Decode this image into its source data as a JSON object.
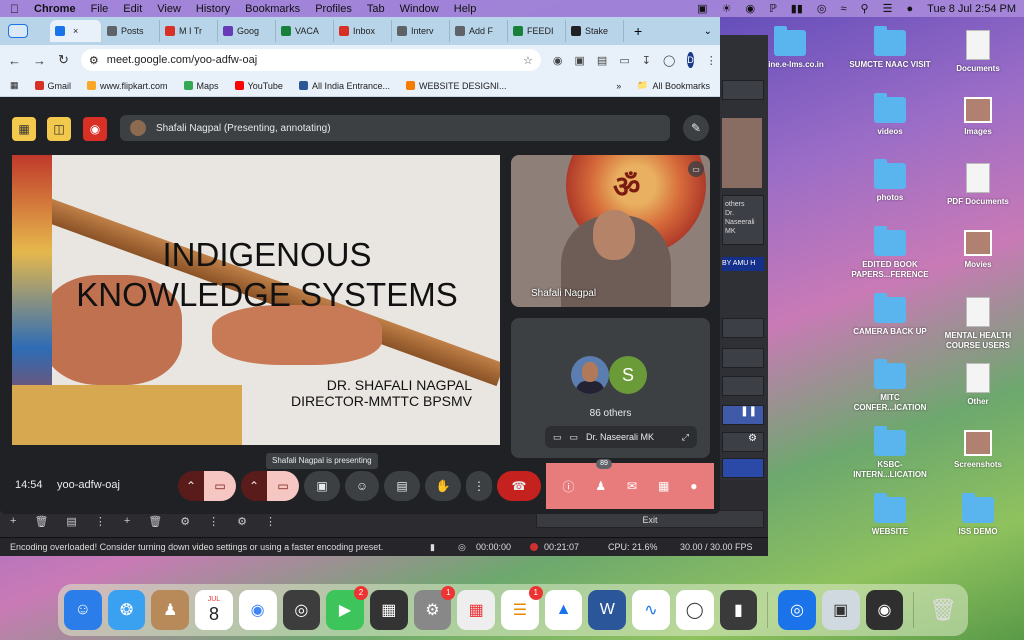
{
  "menubar": {
    "app": "Chrome",
    "items": [
      "File",
      "Edit",
      "View",
      "History",
      "Bookmarks",
      "Profiles",
      "Tab",
      "Window",
      "Help"
    ],
    "clock": "Tue 8 Jul  2:54 PM"
  },
  "tabs": [
    {
      "label": "",
      "color": "#1a73e8"
    },
    {
      "label": "Posts",
      "color": "#5f6368"
    },
    {
      "label": "M I Tr",
      "color": "#d93025"
    },
    {
      "label": "Goog",
      "color": "#673ab7"
    },
    {
      "label": "VACA",
      "color": "#188038"
    },
    {
      "label": "Inbox",
      "color": "#d93025"
    },
    {
      "label": "Interv",
      "color": "#5f6368"
    },
    {
      "label": "Add F",
      "color": "#5f6368"
    },
    {
      "label": "FEEDI",
      "color": "#188038"
    },
    {
      "label": "Stake",
      "color": "#202124"
    }
  ],
  "url": "meet.google.com/yoo-adfw-oaj",
  "profile_initial": "D",
  "bookmarks": [
    {
      "label": "Gmail",
      "color": "#d93025"
    },
    {
      "label": "www.flipkart.com",
      "color": "#f9a825"
    },
    {
      "label": "Maps",
      "color": "#34a853"
    },
    {
      "label": "YouTube",
      "color": "#ff0000"
    },
    {
      "label": "All India Entrance...",
      "color": "#2b5797"
    },
    {
      "label": "WEBSITE DESIGNI...",
      "color": "#f57c00"
    }
  ],
  "all_bookmarks": "All Bookmarks",
  "meet": {
    "presenter_bar": "Shafali Nagpal (Presenting, annotating)",
    "slide_title": "INDIGENOUS KNOWLEDGE SYSTEMS",
    "slide_author_1": "DR. SHAFALI NAGPAL",
    "slide_author_2": "DIRECTOR-MMTTC BPSMV",
    "speaker_name": "Shafali Nagpal",
    "others_initial": "S",
    "others_count": "86 others",
    "others_name": "Dr. Naseerali MK",
    "time": "14:54",
    "code": "yoo-adfw-oaj",
    "tooltip": "Shafali Nagpal is presenting",
    "participants_badge": "89"
  },
  "obs": {
    "exit": "Exit",
    "status_msg": "Encoding overloaded! Consider turning down video settings or using a faster encoding preset.",
    "net_time": "00:00:00",
    "rec_time": "00:21:07",
    "cpu": "CPU: 21.6%",
    "fps": "30.00 / 30.00 FPS",
    "side_label": "BY AMU H",
    "side_others": "others",
    "side_name": "Dr. Naseerali MK"
  },
  "desktop": [
    {
      "label": "online.e-lms.co.in",
      "type": "folder"
    },
    {
      "label": "SUMCTE NAAC VISIT",
      "type": "folder"
    },
    {
      "label": "Documents",
      "type": "doc"
    },
    {
      "label": "videos",
      "type": "folder"
    },
    {
      "label": "Images",
      "type": "img"
    },
    {
      "label": "photos",
      "type": "folder"
    },
    {
      "label": "PDF Documents",
      "type": "doc"
    },
    {
      "label": "EDITED BOOK PAPERS...FERENCE",
      "type": "folder"
    },
    {
      "label": "Movies",
      "type": "img"
    },
    {
      "label": "CAMERA BACK UP",
      "type": "folder"
    },
    {
      "label": "MENTAL HEALTH COURSE USERS",
      "type": "doc"
    },
    {
      "label": "MITC CONFER...ICATION",
      "type": "folder"
    },
    {
      "label": "Other",
      "type": "doc"
    },
    {
      "label": "KSBC-INTERN...LICATION",
      "type": "folder"
    },
    {
      "label": "Screenshots",
      "type": "img"
    },
    {
      "label": "WEBSITE",
      "type": "folder"
    },
    {
      "label": "ISS DEMO",
      "type": "folder"
    }
  ],
  "dock": {
    "calendar_month": "JUL",
    "calendar_day": "8",
    "badges": {
      "facetime": "2",
      "settings": "1",
      "reminders": "1"
    }
  }
}
